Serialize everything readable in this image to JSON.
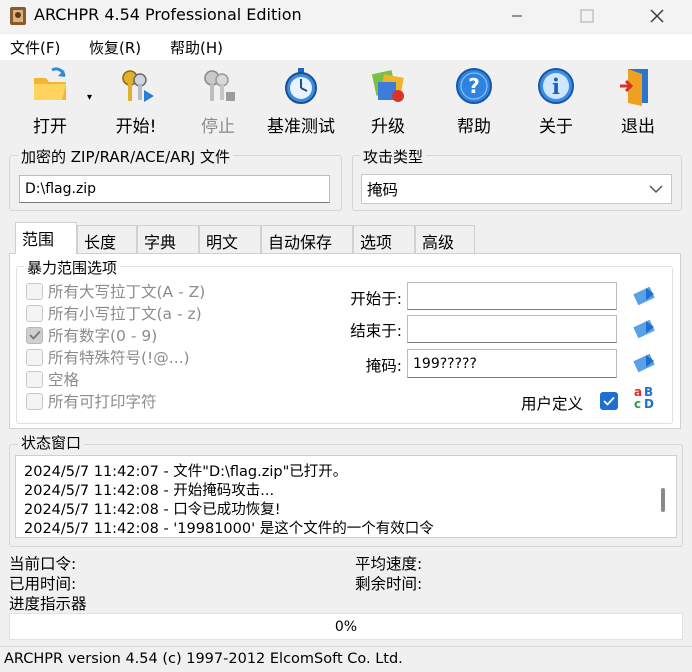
{
  "window": {
    "title": "ARCHPR 4.54 Professional Edition"
  },
  "menu": [
    "文件(F)",
    "恢复(R)",
    "帮助(H)"
  ],
  "toolbar": {
    "open": "打开",
    "start": "开始!",
    "stop": "停止",
    "benchmark": "基准测试",
    "upgrade": "升级",
    "help": "帮助",
    "about": "关于",
    "exit": "退出"
  },
  "encrypted_file": {
    "label": "加密的 ZIP/RAR/ACE/ARJ 文件",
    "value": "D:\\flag.zip"
  },
  "attack_type": {
    "label": "攻击类型",
    "value": "掩码"
  },
  "tabs": [
    "范围",
    "长度",
    "字典",
    "明文",
    "自动保存",
    "选项",
    "高级"
  ],
  "brute_force": {
    "title": "暴力范围选项",
    "options": [
      {
        "label": "所有大写拉丁文(A - Z)",
        "checked": false
      },
      {
        "label": "所有小写拉丁文(a - z)",
        "checked": false
      },
      {
        "label": "所有数字(0 - 9)",
        "checked": true
      },
      {
        "label": "所有特殊符号(!@...)",
        "checked": false
      },
      {
        "label": "空格",
        "checked": false
      },
      {
        "label": "所有可打印字符",
        "checked": false
      }
    ],
    "start_label": "开始于:",
    "start_value": "",
    "end_label": "结束于:",
    "end_value": "",
    "mask_label": "掩码:",
    "mask_value": "199?????",
    "user_defined_label": "用户定义",
    "user_defined_checked": true
  },
  "status": {
    "title": "状态窗口",
    "lines": [
      "2024/5/7 11:42:07 - 文件\"D:\\flag.zip\"已打开。",
      "2024/5/7 11:42:08 - 开始掩码攻击...",
      "2024/5/7 11:42:08 - 口令已成功恢复!",
      "2024/5/7 11:42:08 - '19981000' 是这个文件的一个有效口令"
    ]
  },
  "info": {
    "current_password": "当前口令:",
    "avg_speed": "平均速度:",
    "time_elapsed": "已用时间:",
    "time_remaining": "剩余时间:",
    "progress_indicator": "进度指示器"
  },
  "progress": {
    "text": "0%",
    "value": 0
  },
  "statusbar": "ARCHPR version 4.54 (c) 1997-2012 ElcomSoft Co. Ltd.",
  "colors": {
    "accent_blue": "#1e6fd0",
    "background": "#f0f0f0"
  }
}
